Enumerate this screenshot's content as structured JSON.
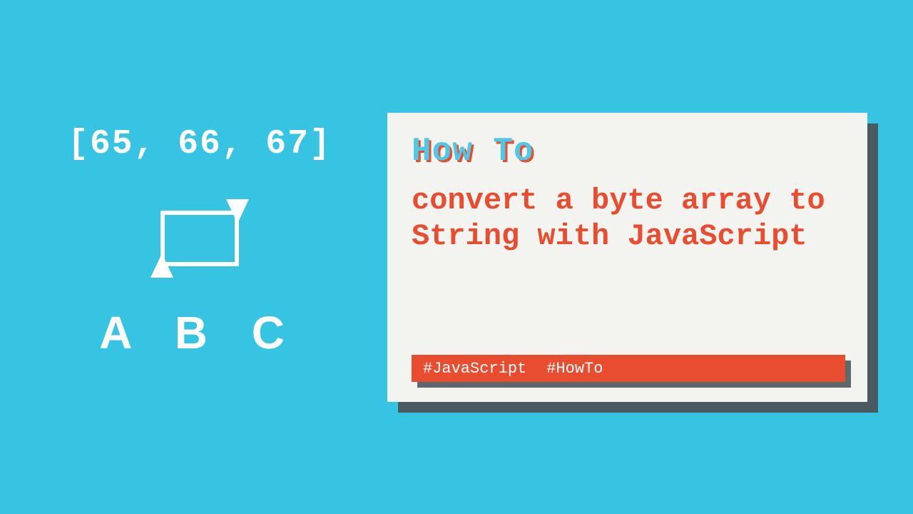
{
  "illustration": {
    "byte_array_text": "[65, 66, 67]",
    "result_text": "A B C"
  },
  "card": {
    "eyebrow": "How To",
    "title": "convert a byte array to String with JavaScript",
    "tags": [
      "#JavaScript",
      "#HowTo"
    ]
  },
  "colors": {
    "background": "#36c4e2",
    "accent": "#e84d30",
    "card_bg": "#f3f4f0",
    "shadow": "#4a5a5e"
  }
}
